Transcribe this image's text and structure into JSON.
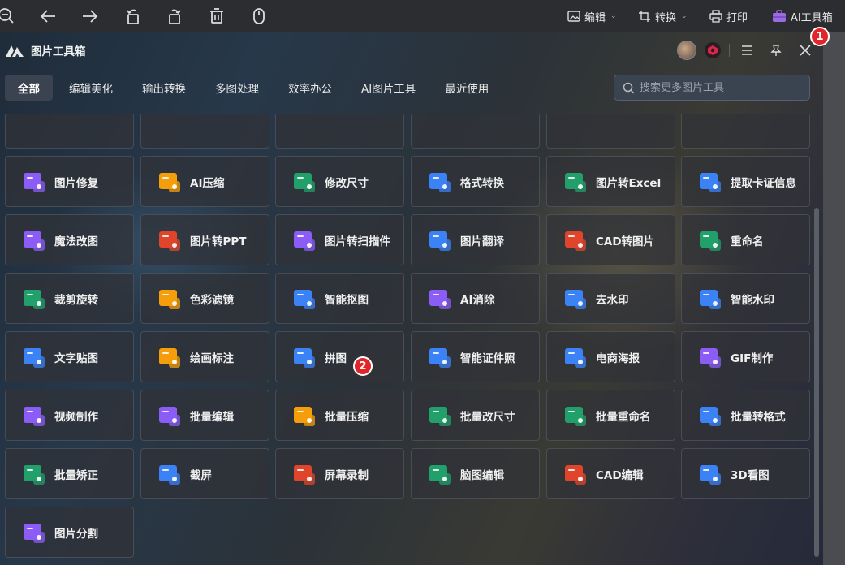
{
  "topbar": {
    "icons": [
      "zoom-out-icon",
      "back-arrow-icon",
      "forward-arrow-icon",
      "rotate-left-icon",
      "rotate-right-icon",
      "delete-icon",
      "mouse-icon"
    ],
    "edit_label": "编辑",
    "convert_label": "转换",
    "print_label": "打印",
    "ai_toolbox_label": "AI工具箱"
  },
  "header": {
    "title": "图片工具箱"
  },
  "tabs": [
    "全部",
    "编辑美化",
    "输出转换",
    "多图处理",
    "效率办公",
    "AI图片工具",
    "最近使用"
  ],
  "active_tab": "全部",
  "search": {
    "placeholder": "搜索更多图片工具"
  },
  "tools": [
    "图片修复",
    "AI压缩",
    "修改尺寸",
    "格式转换",
    "图片转Excel",
    "提取卡证信息",
    "魔法改图",
    "图片转PPT",
    "图片转扫描件",
    "图片翻译",
    "CAD转图片",
    "重命名",
    "裁剪旋转",
    "色彩滤镜",
    "智能抠图",
    "AI消除",
    "去水印",
    "智能水印",
    "文字贴图",
    "绘画标注",
    "拼图",
    "智能证件照",
    "电商海报",
    "GIF制作",
    "视频制作",
    "批量编辑",
    "批量压缩",
    "批量改尺寸",
    "批量重命名",
    "批量转格式",
    "批量矫正",
    "截屏",
    "屏幕录制",
    "脑图编辑",
    "CAD编辑",
    "3D看图",
    "图片分割"
  ],
  "markers": [
    "1",
    "2"
  ],
  "colors": {
    "accent_red": "#e0262a",
    "tab_active_bg": "#3b4350"
  }
}
